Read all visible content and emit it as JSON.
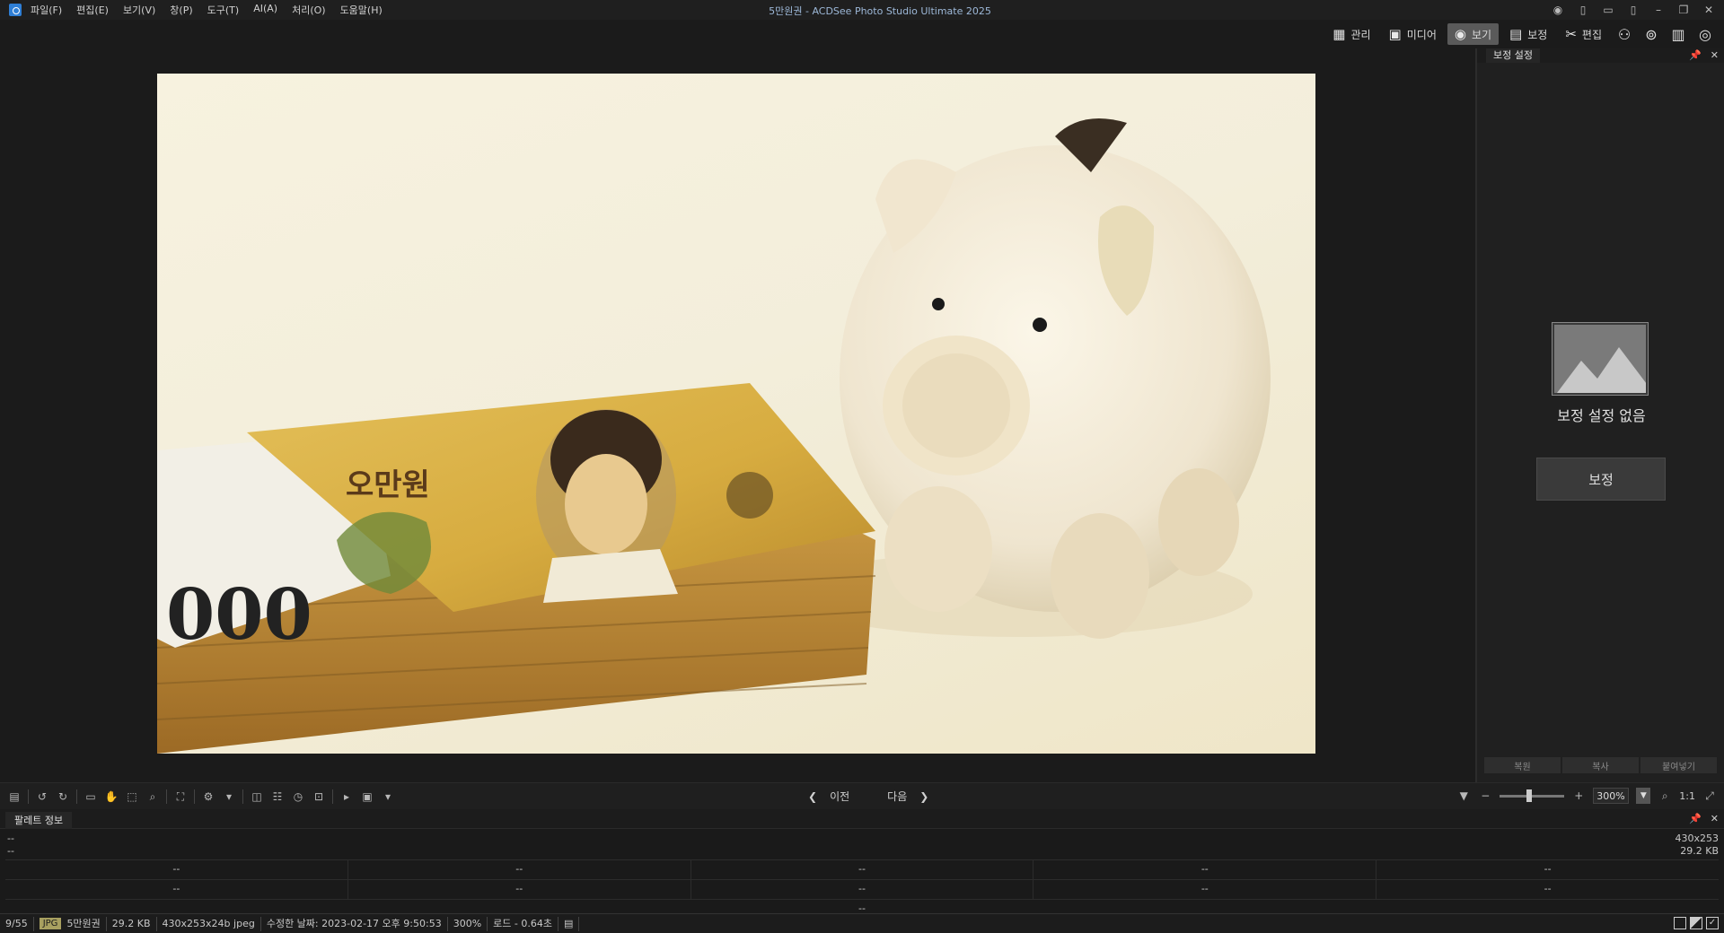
{
  "titlebar": {
    "window_title": "5만원권 - ACDSee Photo Studio Ultimate 2025",
    "menu": [
      "파일(F)",
      "편집(E)",
      "보기(V)",
      "창(P)",
      "도구(T)",
      "AI(A)",
      "처리(O)",
      "도움말(H)"
    ]
  },
  "modes": {
    "manage": "관리",
    "media": "미디어",
    "view": "보기",
    "develop": "보정",
    "edit": "편집",
    "active": "view"
  },
  "photo": {
    "subject": "50000 won banknotes and piggy bank",
    "banknote_label": "오만원"
  },
  "right_panel": {
    "tab": "보정 설정",
    "empty_text": "보정 설정 없음",
    "develop_button": "보정",
    "buttons": [
      "복원",
      "복사",
      "붙여넣기"
    ]
  },
  "bottom_toolbar": {
    "prev": "이전",
    "next": "다음",
    "zoom_value": "300%",
    "zoom_ratio": "1:1"
  },
  "info_palette": {
    "tab": "팔레트 정보",
    "line1_left": "--",
    "line2_left": "--",
    "dimensions": "430x253",
    "size": "29.2 KB",
    "grid": [
      [
        "--",
        "--",
        "--",
        "--",
        "--"
      ],
      [
        "--",
        "--",
        "--",
        "--",
        "--"
      ]
    ],
    "bottom_value": "--"
  },
  "statusbar": {
    "index": "9/55",
    "format": "JPG",
    "filename": "5만원권",
    "filesize": "29.2 KB",
    "image_info": "430x253x24b jpeg",
    "modified": "수정한 날짜: 2023-02-17 오후 9:50:53",
    "zoom": "300%",
    "load_time": "로드 - 0.64초"
  }
}
